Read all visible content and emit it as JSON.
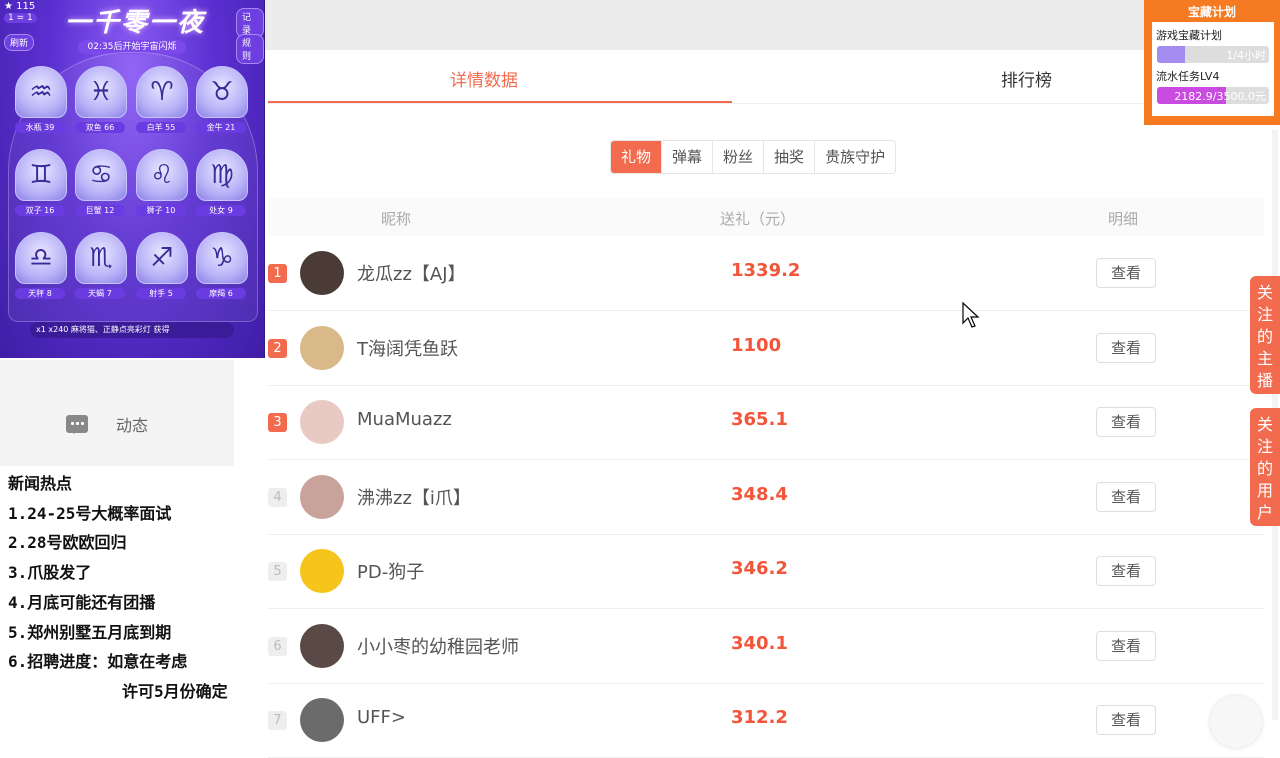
{
  "promo": {
    "title": "一千零一夜",
    "count": "115",
    "exchange": "1 = 1",
    "record": "记录",
    "refresh": "刷新",
    "rules": "规则",
    "timer": "02:35后开始宇宙闪烁",
    "zodiacs": [
      {
        "name": "水瓶 39",
        "icon": "♒"
      },
      {
        "name": "双鱼 66",
        "icon": "♓"
      },
      {
        "name": "白羊 55",
        "icon": "♈"
      },
      {
        "name": "金牛 21",
        "icon": "♉"
      },
      {
        "name": "双子 16",
        "icon": "♊"
      },
      {
        "name": "巨蟹 12",
        "icon": "♋"
      },
      {
        "name": "狮子 10",
        "icon": "♌"
      },
      {
        "name": "处女 9",
        "icon": "♍"
      },
      {
        "name": "天秤 8",
        "icon": "♎"
      },
      {
        "name": "天蝎 7",
        "icon": "♏"
      },
      {
        "name": "射手 5",
        "icon": "♐"
      },
      {
        "name": "摩羯 6",
        "icon": "♑"
      }
    ],
    "footer": "x1  x240  麻将猫、正静点亮彩灯 获得"
  },
  "sidebar": {
    "feed_label": "动态"
  },
  "news": {
    "title": "新闻热点",
    "items": [
      "1.24-25号大概率面试",
      "2.28号欧欧回归",
      "3.爪股发了",
      "4.月底可能还有团播",
      "5.郑州别墅五月底到期",
      "6.招聘进度：如意在考虑",
      "许可5月份确定"
    ]
  },
  "tabs": {
    "detail": "详情数据",
    "rank": "排行榜"
  },
  "filters": [
    "礼物",
    "弹幕",
    "粉丝",
    "抽奖",
    "贵族守护"
  ],
  "table": {
    "headers": {
      "nick": "昵称",
      "gift": "送礼（元）",
      "detail": "明细"
    },
    "view_label": "查看",
    "rows": [
      {
        "rank": "1",
        "nick": "龙瓜zz【AJ】",
        "amount": "1339.2"
      },
      {
        "rank": "2",
        "nick": "T海阔凭鱼跃",
        "amount": "1100"
      },
      {
        "rank": "3",
        "nick": "MuaMuazz",
        "amount": "365.1"
      },
      {
        "rank": "4",
        "nick": "沸沸zz【i爪】",
        "amount": "348.4"
      },
      {
        "rank": "5",
        "nick": "PD-狗子",
        "amount": "346.2"
      },
      {
        "rank": "6",
        "nick": "小小枣的幼稚园老师",
        "amount": "340.1"
      },
      {
        "rank": "7",
        "nick": "UFF>",
        "amount": "312.2"
      }
    ]
  },
  "plan": {
    "title": "宝藏计划",
    "task1": "游戏宝藏计划",
    "task1_progress": "1/4小时",
    "task1_fraction": 0.25,
    "task2": "流水任务LV4",
    "task2_progress": "2182.9/3500.0元",
    "task2_fraction": 0.62
  },
  "follow": {
    "anchor": "关注的主播",
    "users": "关注的用户"
  },
  "colors": {
    "accent": "#f26b4e",
    "amount": "#f2553a",
    "plan": "#f57a22"
  }
}
